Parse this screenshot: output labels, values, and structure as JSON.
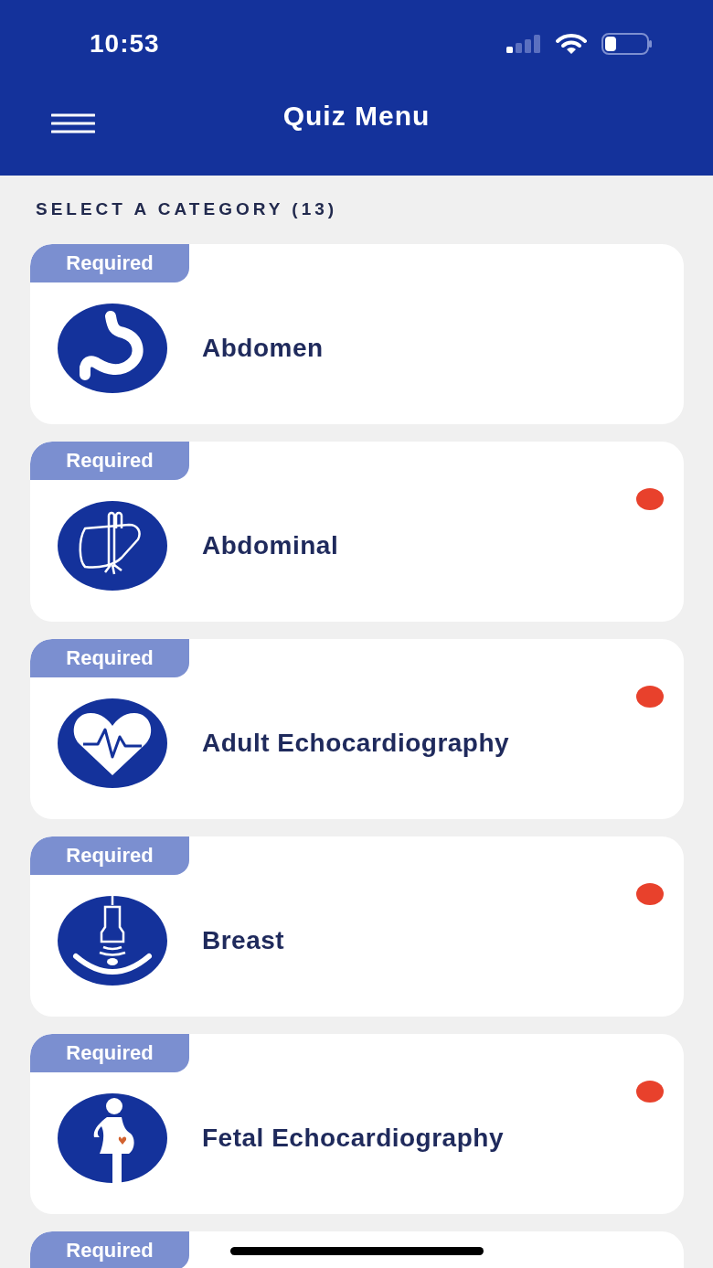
{
  "status_bar": {
    "time": "10:53"
  },
  "header": {
    "title": "Quiz Menu"
  },
  "section_label": "SELECT A CATEGORY (13)",
  "categories": [
    {
      "tag": "Required",
      "kind": "stomach",
      "title": "Abdomen",
      "unread": false
    },
    {
      "tag": "Required",
      "kind": "liver",
      "title": "Abdominal",
      "unread": true
    },
    {
      "tag": "Required",
      "kind": "heart",
      "title": "Adult Echocardiography",
      "unread": true
    },
    {
      "tag": "Required",
      "kind": "probe",
      "title": "Breast",
      "unread": true
    },
    {
      "tag": "Required",
      "kind": "pregnant",
      "title": "Fetal Echocardiography",
      "unread": true
    },
    {
      "tag": "Required"
    }
  ]
}
